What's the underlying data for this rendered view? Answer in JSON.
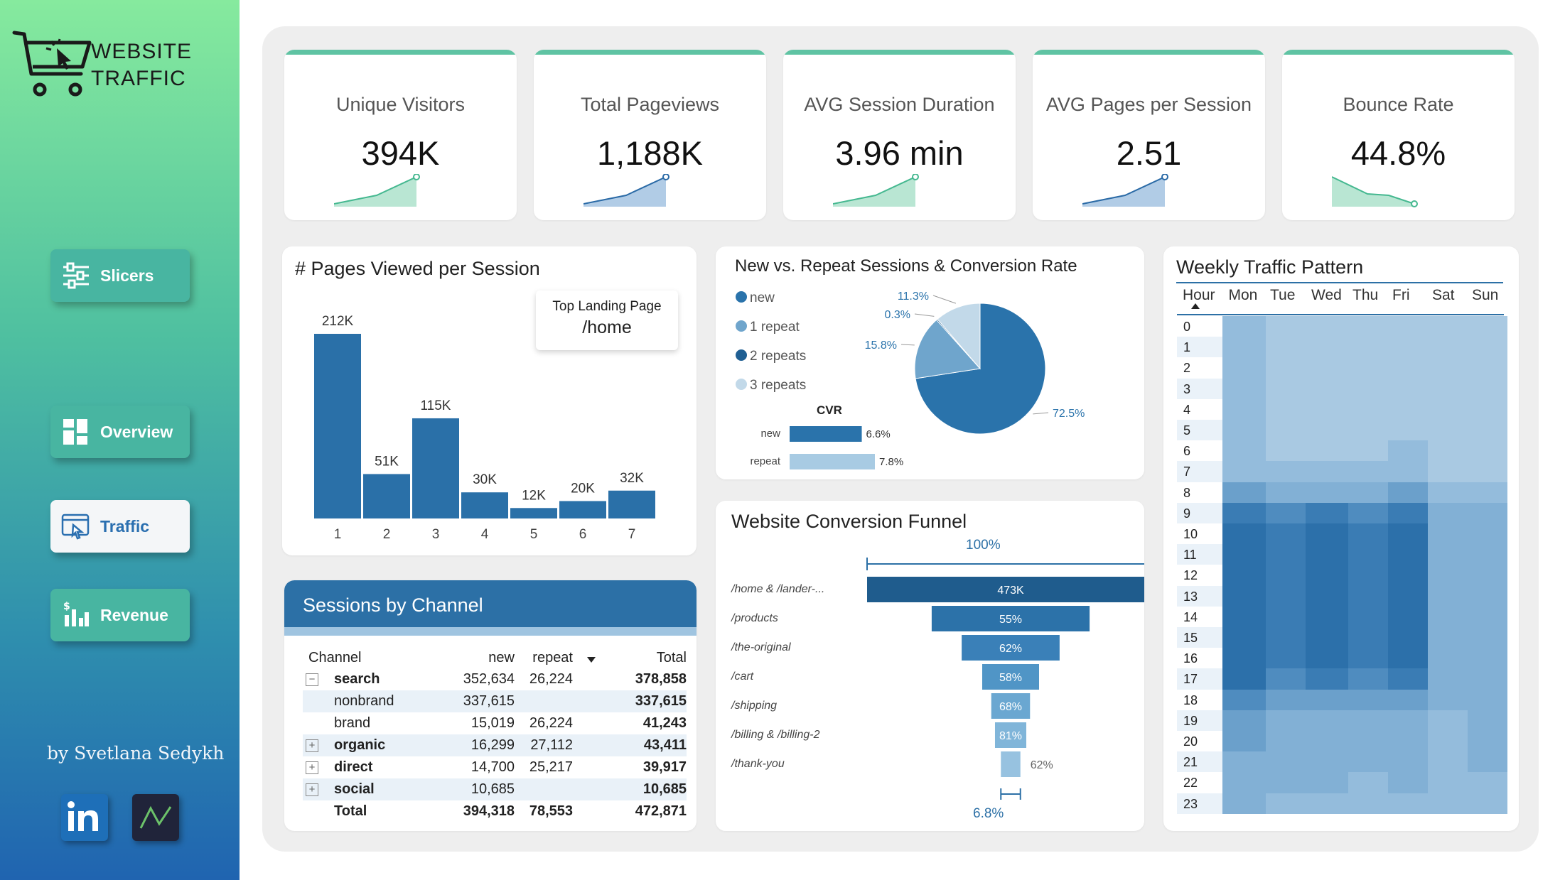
{
  "app": {
    "title_line1": "WEBSITE",
    "title_line2": "TRAFFIC",
    "author": "by Svetlana Sedykh"
  },
  "nav": {
    "slicers": "Slicers",
    "overview": "Overview",
    "traffic": "Traffic",
    "revenue": "Revenue"
  },
  "kpis": [
    {
      "label": "Unique Visitors",
      "value": "394K",
      "trend": "up"
    },
    {
      "label": "Total Pageviews",
      "value": "1,188K",
      "trend": "up"
    },
    {
      "label": "AVG Session Duration",
      "value": "3.96 min",
      "trend": "up"
    },
    {
      "label": "AVG Pages per Session",
      "value": "2.51",
      "trend": "up"
    },
    {
      "label": "Bounce Rate",
      "value": "44.8%",
      "trend": "down"
    }
  ],
  "pages_chart": {
    "title": "# Pages Viewed per Session",
    "landing_label": "Top Landing Page",
    "landing_value": "/home"
  },
  "sessions_chart": {
    "title": "New vs. Repeat Sessions & Conversion Rate",
    "legend": [
      "new",
      "1 repeat",
      "2 repeats",
      "3 repeats"
    ],
    "cvr_title": "CVR",
    "cvr_rows": [
      {
        "label": "new",
        "value": "6.6%"
      },
      {
        "label": "repeat",
        "value": "7.8%"
      }
    ],
    "slice_labels": [
      "72.5%",
      "15.8%",
      "0.3%",
      "11.3%"
    ]
  },
  "heatmap": {
    "title": "Weekly Traffic Pattern",
    "hour_label": "Hour",
    "days": [
      "Mon",
      "Tue",
      "Wed",
      "Thu",
      "Fri",
      "Sat",
      "Sun"
    ],
    "hours": [
      "0",
      "1",
      "2",
      "3",
      "4",
      "5",
      "6",
      "7",
      "8",
      "9",
      "10",
      "11",
      "12",
      "13",
      "14",
      "15",
      "16",
      "17",
      "18",
      "19",
      "20",
      "21",
      "22",
      "23"
    ]
  },
  "channels": {
    "title": "Sessions by Channel",
    "columns": [
      "Channel",
      "new",
      "repeat",
      "Total"
    ],
    "rows": [
      {
        "channel": "search",
        "new": "352,634",
        "repeat": "26,224",
        "total": "378,858",
        "bold": true,
        "expander": "−"
      },
      {
        "channel": "nonbrand",
        "new": "337,615",
        "repeat": "",
        "total": "337,615",
        "bold": false,
        "expander": ""
      },
      {
        "channel": "brand",
        "new": "15,019",
        "repeat": "26,224",
        "total": "41,243",
        "bold": false,
        "expander": ""
      },
      {
        "channel": "organic",
        "new": "16,299",
        "repeat": "27,112",
        "total": "43,411",
        "bold": true,
        "expander": "+"
      },
      {
        "channel": "direct",
        "new": "14,700",
        "repeat": "25,217",
        "total": "39,917",
        "bold": true,
        "expander": "+"
      },
      {
        "channel": "social",
        "new": "10,685",
        "repeat": "",
        "total": "10,685",
        "bold": true,
        "expander": "+"
      },
      {
        "channel": "Total",
        "new": "394,318",
        "repeat": "78,553",
        "total": "472,871",
        "bold": true,
        "expander": ""
      }
    ]
  },
  "funnel": {
    "title": "Website Conversion Funnel",
    "top_label": "100%",
    "bottom_label": "6.8%",
    "stages": [
      {
        "label": "/home & /lander-...",
        "value": "473K",
        "fraction": 1.0
      },
      {
        "label": "/products",
        "value": "55%",
        "fraction": 0.55
      },
      {
        "label": "/the-original",
        "value": "62%",
        "fraction": 0.341
      },
      {
        "label": "/cart",
        "value": "58%",
        "fraction": 0.198
      },
      {
        "label": "/shipping",
        "value": "68%",
        "fraction": 0.135
      },
      {
        "label": "/billing & /billing-2",
        "value": "81%",
        "fraction": 0.109
      },
      {
        "label": "/thank-you",
        "value": "62%",
        "fraction": 0.068
      }
    ]
  },
  "chart_data": [
    {
      "type": "bar",
      "title": "# Pages Viewed per Session",
      "categories": [
        "1",
        "2",
        "3",
        "4",
        "5",
        "6",
        "7"
      ],
      "values": [
        212,
        51,
        115,
        30,
        12,
        20,
        32
      ],
      "labels": [
        "212K",
        "51K",
        "115K",
        "30K",
        "12K",
        "20K",
        "32K"
      ],
      "xlabel": "",
      "ylabel": "",
      "ylim": [
        0,
        212
      ],
      "color": "#2a70a8"
    },
    {
      "type": "pie",
      "title": "New vs. Repeat Sessions & Conversion Rate",
      "categories": [
        "new",
        "1 repeat",
        "2 repeats",
        "3 repeats"
      ],
      "values": [
        72.5,
        15.8,
        0.3,
        11.3
      ],
      "colors": [
        "#2a73ab",
        "#6fa5cc",
        "#1f5f93",
        "#c2d9e9"
      ]
    },
    {
      "type": "bar",
      "title": "CVR",
      "categories": [
        "new",
        "repeat"
      ],
      "values": [
        6.6,
        7.8
      ],
      "colors": [
        "#2a73ab",
        "#a8cbe3"
      ]
    },
    {
      "type": "heatmap",
      "title": "Weekly Traffic Pattern",
      "x": [
        "Mon",
        "Tue",
        "Wed",
        "Thu",
        "Fri",
        "Sat",
        "Sun"
      ],
      "y": [
        "0",
        "1",
        "2",
        "3",
        "4",
        "5",
        "6",
        "7",
        "8",
        "9",
        "10",
        "11",
        "12",
        "13",
        "14",
        "15",
        "16",
        "17",
        "18",
        "19",
        "20",
        "21",
        "22",
        "23"
      ],
      "values": [
        [
          3,
          2,
          2,
          2,
          2,
          2,
          2
        ],
        [
          3,
          2,
          2,
          2,
          2,
          2,
          2
        ],
        [
          3,
          2,
          2,
          2,
          2,
          2,
          2
        ],
        [
          3,
          2,
          2,
          2,
          2,
          2,
          2
        ],
        [
          3,
          2,
          2,
          2,
          2,
          2,
          2
        ],
        [
          3,
          2,
          2,
          2,
          2,
          2,
          2
        ],
        [
          3,
          2,
          2,
          2,
          3,
          2,
          2
        ],
        [
          3,
          3,
          3,
          3,
          3,
          2,
          2
        ],
        [
          5,
          4,
          4,
          4,
          5,
          3,
          3
        ],
        [
          7,
          6,
          7,
          6,
          7,
          4,
          4
        ],
        [
          8,
          7,
          8,
          7,
          8,
          4,
          4
        ],
        [
          8,
          7,
          8,
          7,
          8,
          4,
          4
        ],
        [
          8,
          7,
          8,
          7,
          8,
          4,
          4
        ],
        [
          8,
          7,
          8,
          7,
          8,
          4,
          4
        ],
        [
          8,
          7,
          8,
          7,
          8,
          4,
          4
        ],
        [
          8,
          7,
          8,
          7,
          8,
          4,
          4
        ],
        [
          8,
          7,
          8,
          7,
          8,
          4,
          4
        ],
        [
          8,
          6,
          7,
          6,
          7,
          4,
          4
        ],
        [
          6,
          5,
          5,
          5,
          5,
          4,
          4
        ],
        [
          5,
          4,
          4,
          4,
          4,
          3,
          4
        ],
        [
          5,
          4,
          4,
          4,
          4,
          3,
          4
        ],
        [
          4,
          4,
          4,
          4,
          4,
          3,
          4
        ],
        [
          4,
          4,
          4,
          3,
          4,
          3,
          3
        ],
        [
          4,
          3,
          3,
          3,
          3,
          3,
          3
        ]
      ]
    }
  ]
}
